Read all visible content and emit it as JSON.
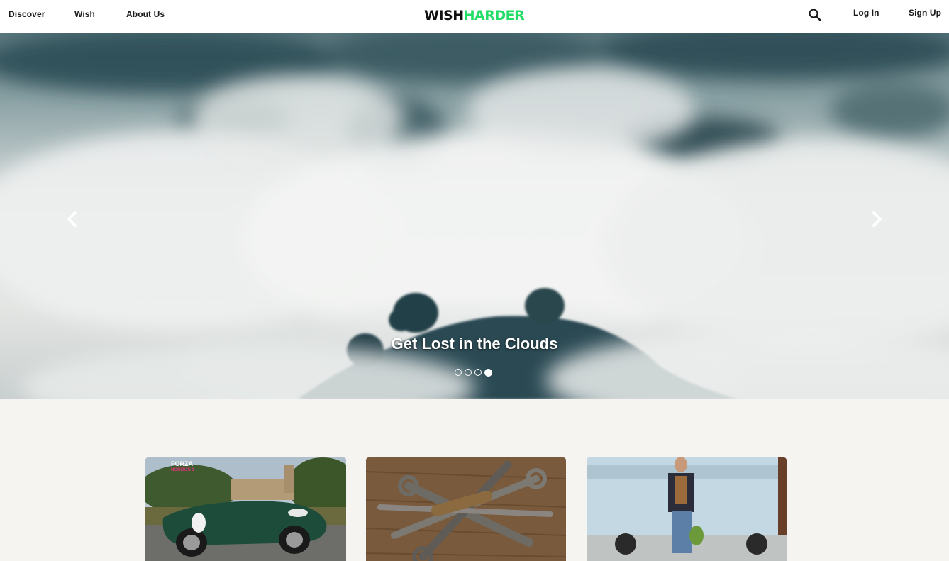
{
  "nav": {
    "discover": "Discover",
    "wish": "Wish",
    "about": "About Us",
    "login": "Log In",
    "signup": "Sign Up"
  },
  "logo": {
    "part1": "WISH",
    "part2": "HARDER",
    "accent_color": "#22dd66"
  },
  "icons": {
    "search": "search-icon",
    "prev": "chevron-left-icon",
    "next": "chevron-right-icon"
  },
  "hero": {
    "caption": "Get Lost in the Clouds",
    "slide_count": 4,
    "active_slide": 4
  },
  "cards": [
    {
      "name": "car-card",
      "overlay_text_1": "FORZA",
      "overlay_text_2": "HORIZON 2"
    },
    {
      "name": "tools-card"
    },
    {
      "name": "fashion-card"
    }
  ]
}
